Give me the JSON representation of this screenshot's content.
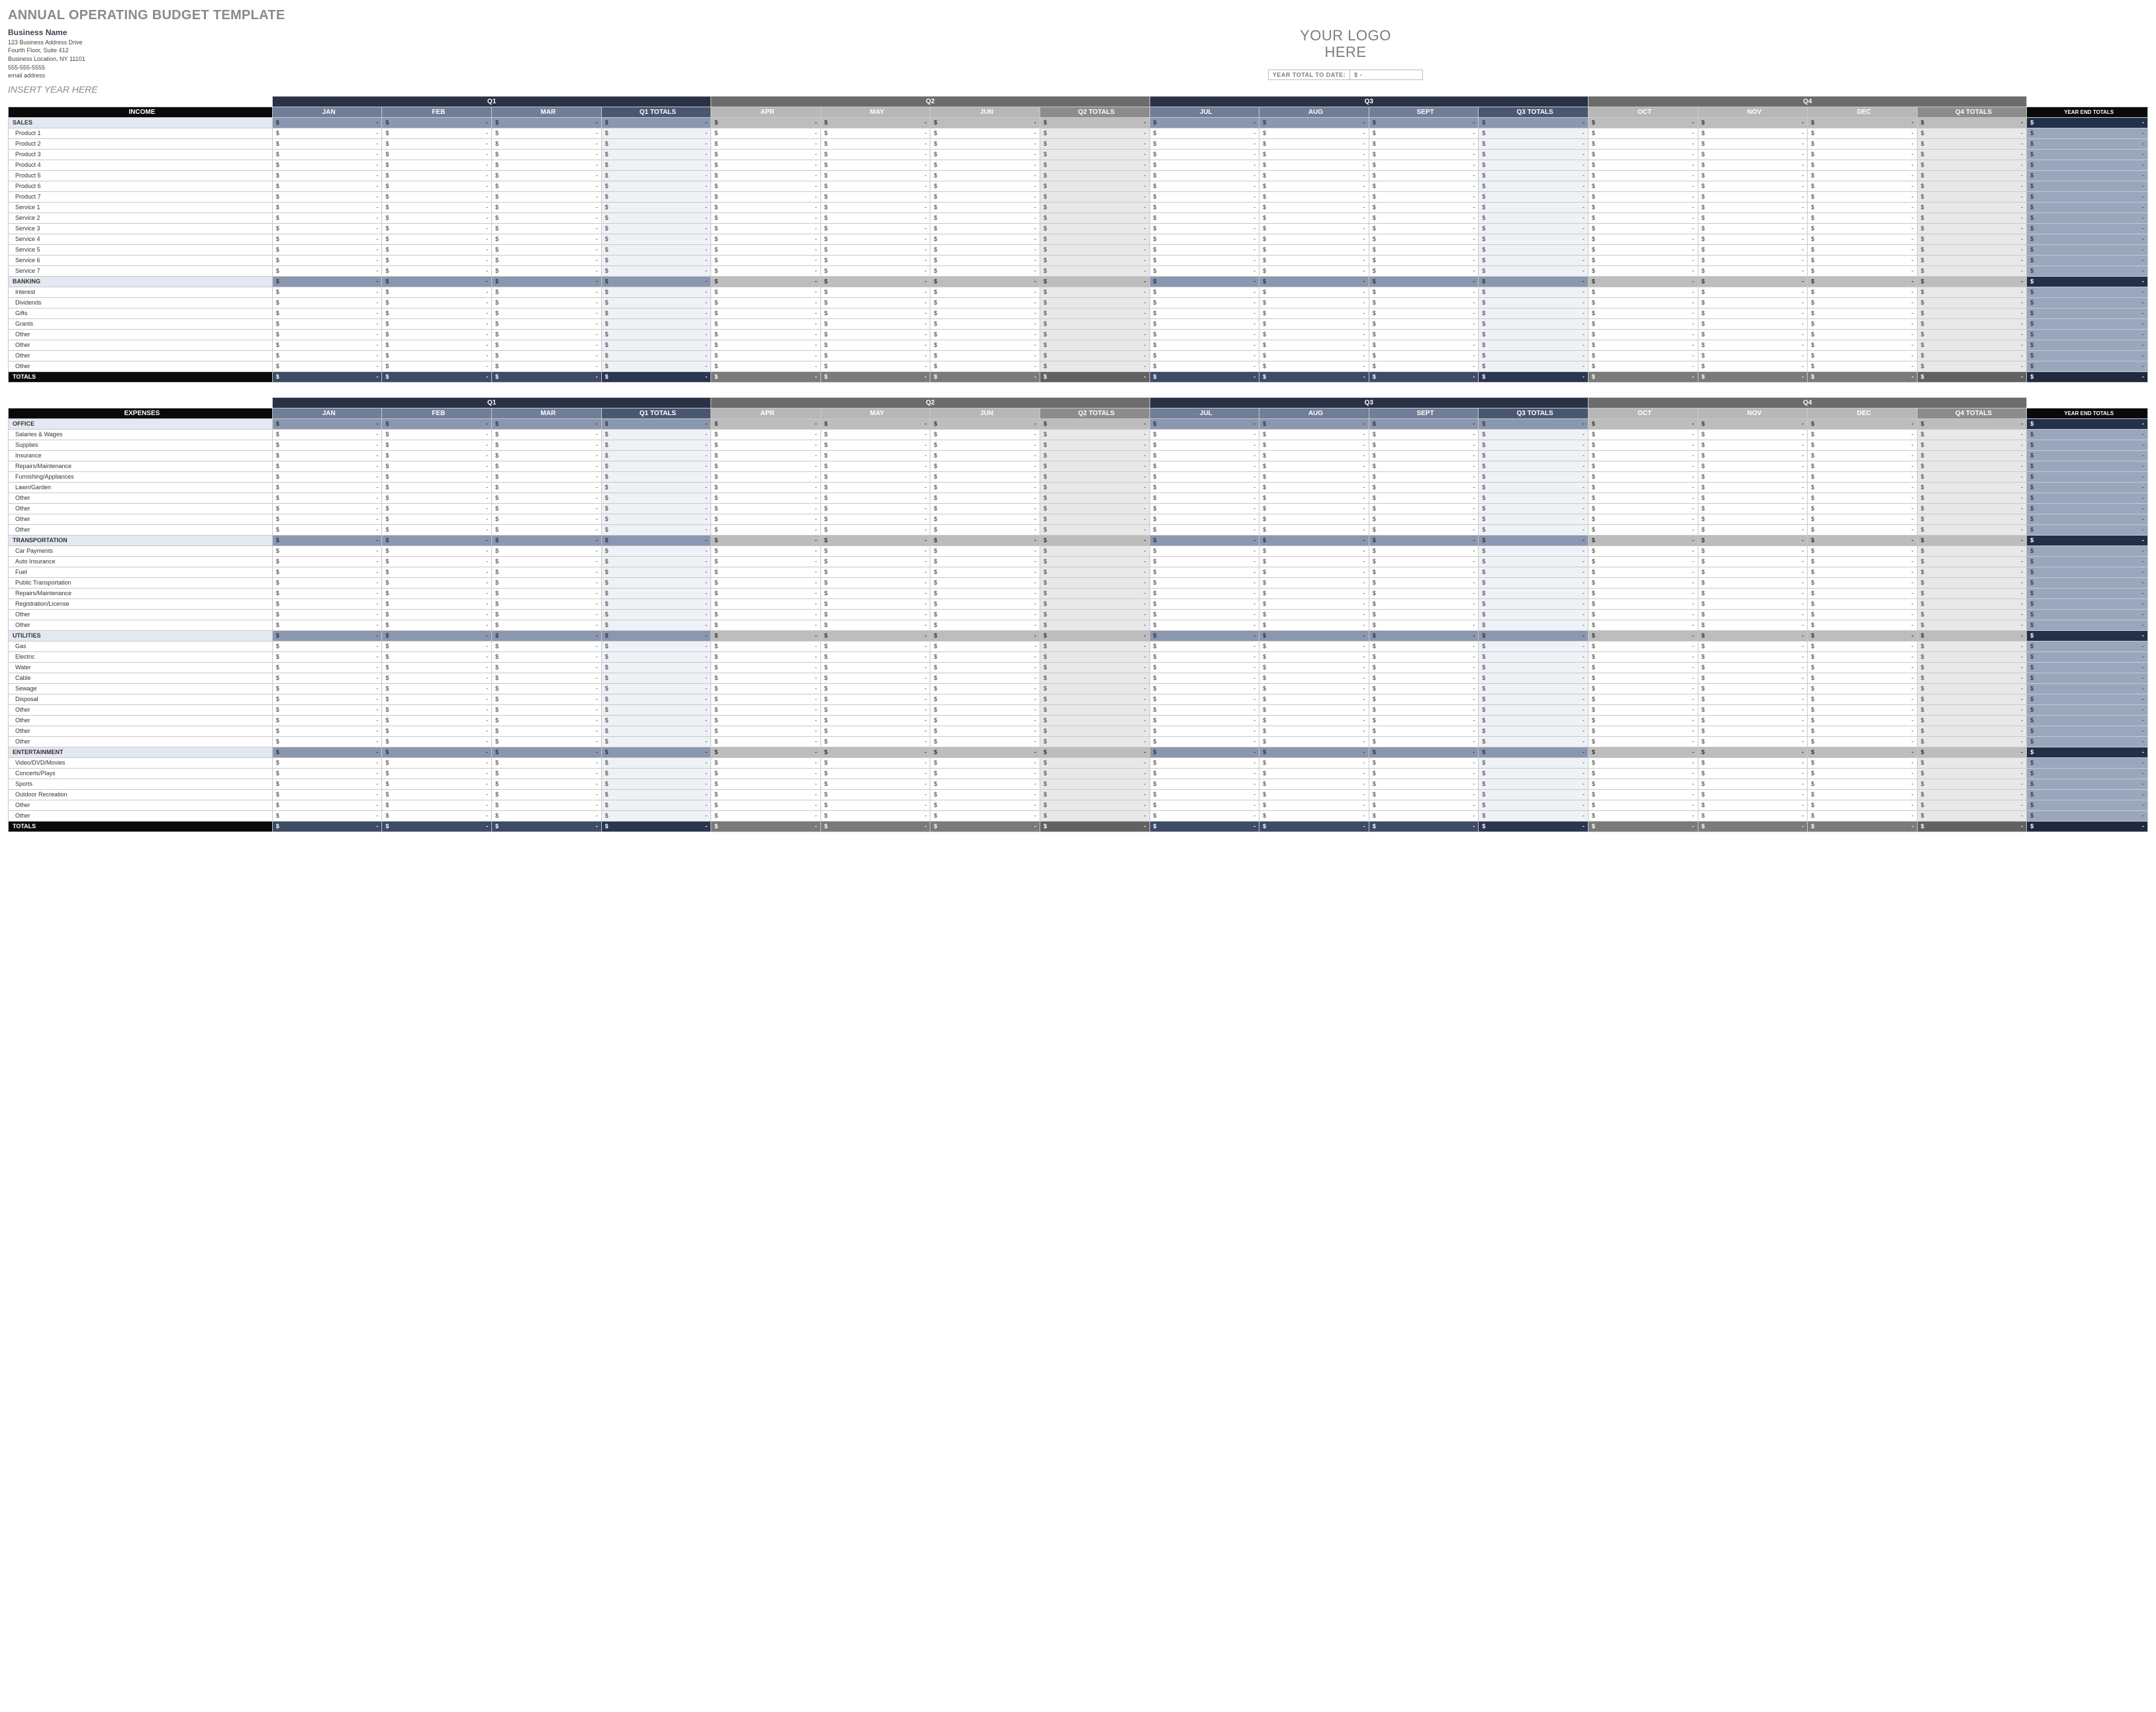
{
  "title": "ANNUAL OPERATING BUDGET TEMPLATE",
  "business": {
    "name": "Business Name",
    "addr1": "123 Business Address Drive",
    "addr2": "Fourth Floor, Suite 412",
    "addr3": "Business Location, NY 11101",
    "phone": "555-555-5555",
    "email": "email address"
  },
  "logo_line1": "YOUR LOGO",
  "logo_line2": "HERE",
  "ytd_label": "YEAR TOTAL TO DATE:",
  "ytd_value": "$          -",
  "year_placeholder": "INSERT YEAR HERE",
  "sym": "$",
  "dash": "-",
  "quarters": [
    "Q1",
    "Q2",
    "Q3",
    "Q4"
  ],
  "months": {
    "q1": [
      "JAN",
      "FEB",
      "MAR"
    ],
    "q1t": "Q1 TOTALS",
    "q2": [
      "APR",
      "MAY",
      "JUN"
    ],
    "q2t": "Q2 TOTALS",
    "q3": [
      "JUL",
      "AUG",
      "SEPT"
    ],
    "q3t": "Q3 TOTALS",
    "q4": [
      "OCT",
      "NOV",
      "DEC"
    ],
    "q4t": "Q4 TOTALS"
  },
  "year_end_label": "YEAR END TOTALS",
  "sections": [
    {
      "header": "INCOME",
      "groups": [
        {
          "name": "SALES",
          "rows": [
            "Product 1",
            "Product 2",
            "Product 3",
            "Product 4",
            "Product 5",
            "Product 6",
            "Product 7",
            "Service 1",
            "Service 2",
            "Service 3",
            "Service 4",
            "Service 5",
            "Service 6",
            "Service 7"
          ]
        },
        {
          "name": "BANKING",
          "rows": [
            "Interest",
            "Dividends",
            "Gifts",
            "Grants",
            "Other",
            "Other",
            "Other",
            "Other"
          ]
        }
      ],
      "totals_label": "TOTALS"
    },
    {
      "header": "EXPENSES",
      "groups": [
        {
          "name": "OFFICE",
          "rows": [
            "Salaries & Wages",
            "Supplies",
            "Insurance",
            "Repairs/Maintenance",
            "Furnishing/Appliances",
            "Lawn/Garden",
            "Other",
            "Other",
            "Other",
            "Other"
          ]
        },
        {
          "name": "TRANSPORTATION",
          "rows": [
            "Car Payments",
            "Auto Insurance",
            "Fuel",
            "Public Transportation",
            "Repairs/Maintenance",
            "Registration/License",
            "Other",
            "Other"
          ]
        },
        {
          "name": "UTILITIES",
          "rows": [
            "Gas",
            "Electric",
            "Water",
            "Cable",
            "Sewage",
            "Disposal",
            "Other",
            "Other",
            "Other",
            "Other"
          ]
        },
        {
          "name": "ENTERTAINMENT",
          "rows": [
            "Video/DVD/Movies",
            "Concerts/Plays",
            "Sports",
            "Outdoor Recreation",
            "Other",
            "Other"
          ]
        }
      ],
      "totals_label": "TOTALS"
    }
  ]
}
